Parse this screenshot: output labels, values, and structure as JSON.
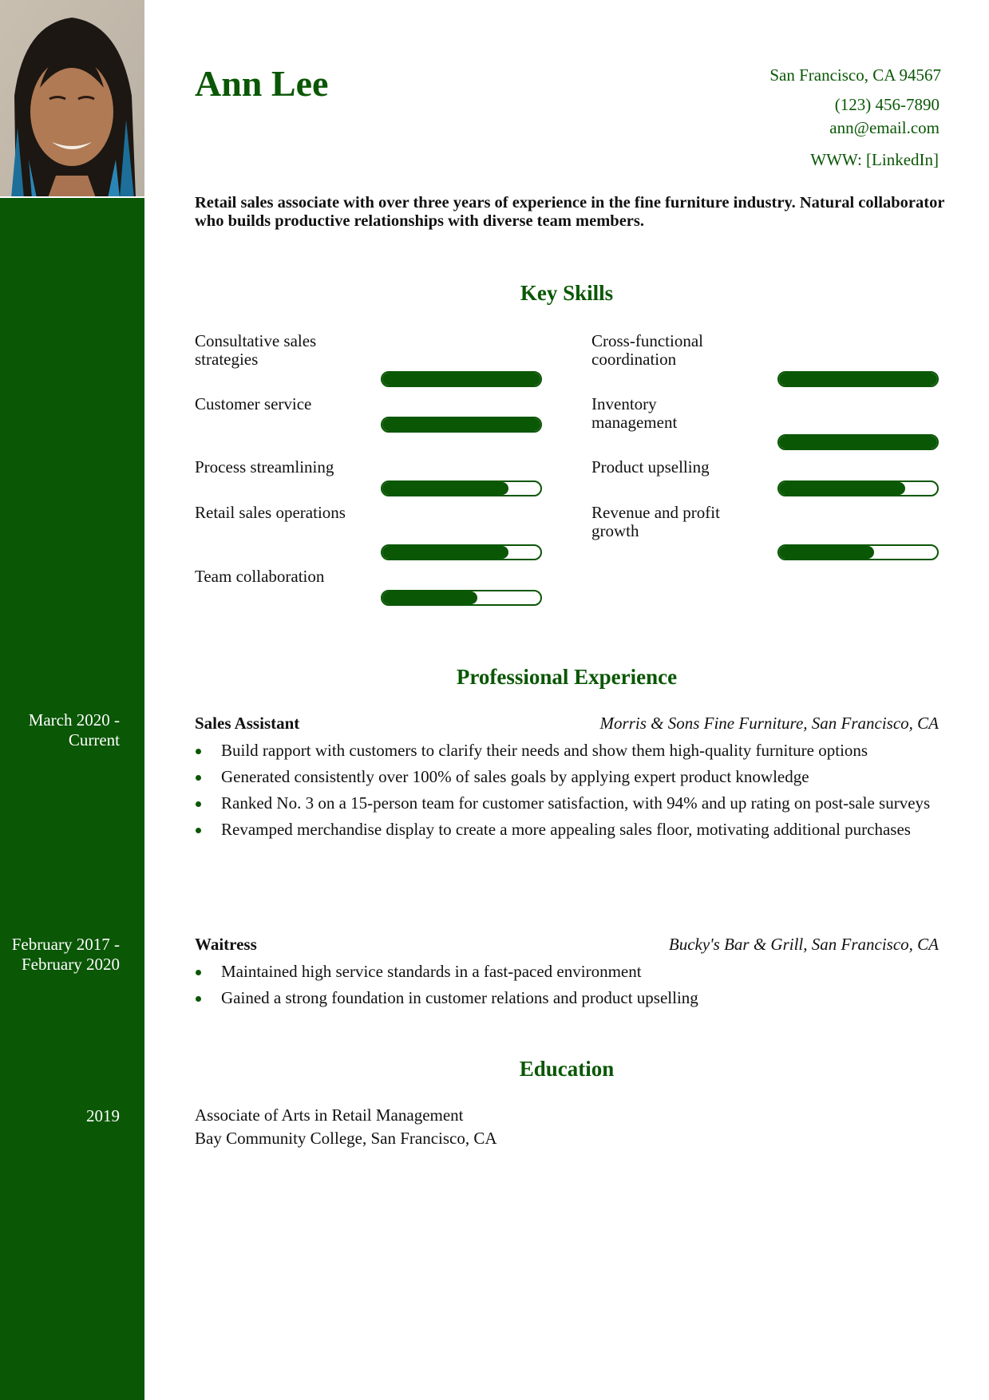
{
  "header": {
    "name": "Ann Lee",
    "contact": {
      "address": "San Francisco, CA 94567",
      "phone": "(123) 456-7890",
      "email": "ann@email.com",
      "website": "WWW: [LinkedIn]"
    }
  },
  "summary": "Retail sales associate with over three years of experience in the fine furniture industry. Natural collaborator who builds productive relationships with diverse team members.",
  "skills": {
    "title": "Key Skills",
    "items": [
      {
        "label": "Consultative sales strategies",
        "level": 1.0
      },
      {
        "label": "Cross-functional coordination",
        "level": 1.0
      },
      {
        "label": "Customer service",
        "level": 1.0
      },
      {
        "label": "Inventory management",
        "level": 1.0
      },
      {
        "label": "Process streamlining",
        "level": 0.8
      },
      {
        "label": "Product upselling",
        "level": 0.8
      },
      {
        "label": "Retail sales operations",
        "level": 0.8
      },
      {
        "label": "Revenue and profit growth",
        "level": 0.6
      },
      {
        "label": "Team collaboration",
        "level": 0.6
      }
    ]
  },
  "experience": {
    "title": "Professional Experience",
    "jobs": [
      {
        "dates": "March 2020 - Current",
        "title": "Sales Assistant",
        "company": "Morris & Sons Fine Furniture, San Francisco, CA",
        "bullets": [
          "Build rapport with customers to clarify their needs and show them high-quality furniture options",
          "Generated consistently over 100% of sales goals by applying expert product knowledge",
          "Ranked No. 3 on a 15-person team for customer satisfaction, with 94% and up rating on post-sale surveys",
          "Revamped merchandise display to create a more appealing sales floor, motivating additional purchases"
        ]
      },
      {
        "dates": "February 2017 - February 2020",
        "title": "Waitress",
        "company": "Bucky's Bar & Grill, San Francisco, CA",
        "bullets": [
          "Maintained high service standards in a fast-paced environment",
          "Gained a strong foundation in customer relations and product upselling"
        ]
      }
    ]
  },
  "education": {
    "title": "Education",
    "dates": "2019",
    "degree": "Associate of Arts in Retail Management",
    "school": "Bay Community College, San Francisco, CA"
  },
  "colors": {
    "accent": "#0a5705",
    "text": "#111111"
  }
}
